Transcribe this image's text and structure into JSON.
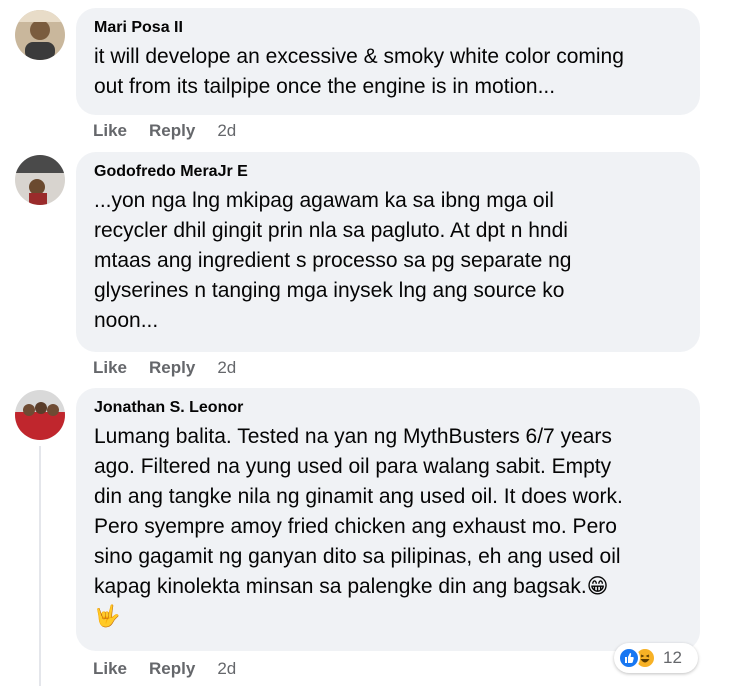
{
  "comments": [
    {
      "author": "Mari Posa II",
      "lines": [
        "it will develope an excessive & smoky white color coming",
        "out from its tailpipe once the engine is in motion..."
      ],
      "actions": {
        "like": "Like",
        "reply": "Reply",
        "time": "2d"
      }
    },
    {
      "author": "Godofredo MeraJr E",
      "lines": [
        "...yon nga lng mkipag agawam ka sa ibng mga oil",
        "recycler dhil gingit prin nla sa pagluto. At dpt n hndi",
        "mtaas ang ingredient s processo sa pg separate ng",
        "glyserines n tanging mga inysek lng ang source ko",
        "noon..."
      ],
      "actions": {
        "like": "Like",
        "reply": "Reply",
        "time": "2d"
      }
    },
    {
      "author": "Jonathan S. Leonor",
      "lines": [
        "Lumang balita. Tested na yan ng MythBusters 6/7 years",
        "ago. Filtered na yung used oil para walang sabit. Empty",
        "din ang tangke nila ng ginamit ang used oil. It does work.",
        "Pero syempre amoy fried chicken ang exhaust mo. Pero",
        "sino gagamit ng ganyan dito sa pilipinas, eh ang used oil",
        "kapag kinolekta minsan sa palengke din ang bagsak.😁",
        "🤟"
      ],
      "actions": {
        "like": "Like",
        "reply": "Reply",
        "time": "2d"
      },
      "reactions": {
        "icons": [
          "like-reaction-icon",
          "haha-reaction-icon"
        ],
        "count": "12"
      }
    }
  ]
}
